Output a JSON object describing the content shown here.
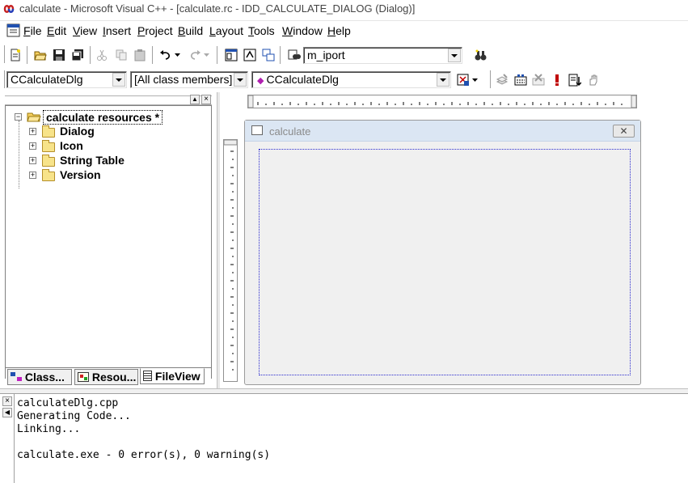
{
  "window": {
    "title": "calculate - Microsoft Visual C++ - [calculate.rc - IDD_CALCULATE_DIALOG (Dialog)]"
  },
  "menu": {
    "items": [
      {
        "pre": "",
        "key": "F",
        "rest": "ile"
      },
      {
        "pre": "",
        "key": "E",
        "rest": "dit"
      },
      {
        "pre": "",
        "key": "V",
        "rest": "iew"
      },
      {
        "pre": "",
        "key": "I",
        "rest": "nsert"
      },
      {
        "pre": "",
        "key": "P",
        "rest": "roject"
      },
      {
        "pre": "",
        "key": "B",
        "rest": "uild"
      },
      {
        "pre": "",
        "key": "L",
        "rest": "ayout"
      },
      {
        "pre": "",
        "key": "T",
        "rest": "ools"
      },
      {
        "pre": "",
        "key": "W",
        "rest": "indow"
      },
      {
        "pre": "",
        "key": "H",
        "rest": "elp"
      }
    ]
  },
  "toolbar": {
    "find_combo_value": "m_iport"
  },
  "wizardbar": {
    "class_combo": "CCalculateDlg",
    "filter_combo": "[All class members]",
    "member_combo": "CCalculateDlg"
  },
  "workspace": {
    "root_label": "calculate resources *",
    "nodes": [
      "Dialog",
      "Icon",
      "String Table",
      "Version"
    ],
    "tabs": [
      "Class...",
      "Resou...",
      "FileView"
    ]
  },
  "dialog": {
    "title": "calculate"
  },
  "output": {
    "lines": [
      "calculateDlg.cpp",
      "Generating Code...",
      "Linking...",
      "",
      "calculate.exe - 0 error(s), 0 warning(s)"
    ]
  },
  "colors": {
    "dialog_title_bg": "#dbe6f3",
    "folder": "#f7e38a",
    "dialog_client_border": "#2a2acf"
  }
}
